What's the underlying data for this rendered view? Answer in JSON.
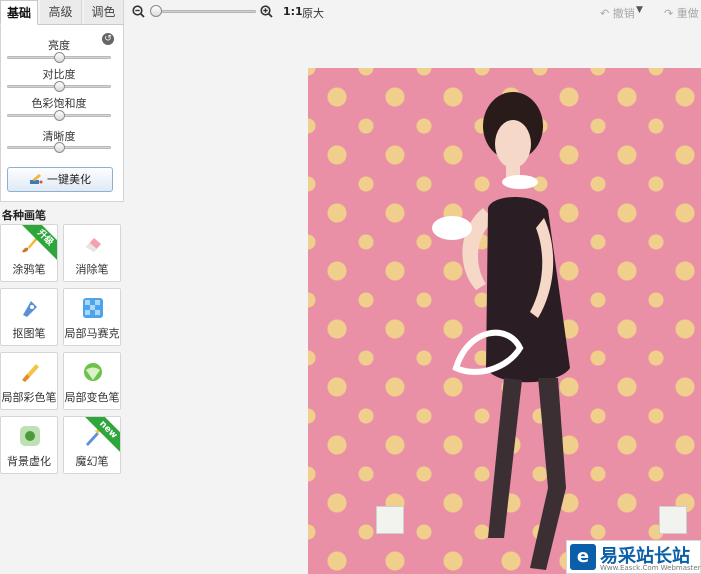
{
  "tabs": [
    {
      "label": "基础",
      "active": true
    },
    {
      "label": "高级",
      "active": false
    },
    {
      "label": "调色",
      "active": false
    }
  ],
  "adjust": {
    "sliders": [
      {
        "label": "亮度",
        "value": 0.5
      },
      {
        "label": "对比度",
        "value": 0.5
      },
      {
        "label": "色彩饱和度",
        "value": 0.5
      },
      {
        "label": "清晰度",
        "value": 0.5
      }
    ],
    "beautify_label": "一键美化"
  },
  "brushes": {
    "title": "各种画笔",
    "tools": [
      {
        "label": "涂鸦笔",
        "badge": "升级",
        "icon": "paintbrush-icon"
      },
      {
        "label": "消除笔",
        "badge": "",
        "icon": "eraser-icon"
      },
      {
        "label": "抠图笔",
        "badge": "",
        "icon": "cutout-pen-icon"
      },
      {
        "label": "局部马赛克",
        "badge": "",
        "icon": "mosaic-icon"
      },
      {
        "label": "局部彩色笔",
        "badge": "",
        "icon": "color-brush-icon"
      },
      {
        "label": "局部变色笔",
        "badge": "",
        "icon": "recolor-brush-icon"
      },
      {
        "label": "背景虚化",
        "badge": "",
        "icon": "blur-background-icon"
      },
      {
        "label": "魔幻笔",
        "badge": "new",
        "icon": "magic-wand-icon"
      }
    ]
  },
  "toolbar": {
    "zoom_level": 0.0,
    "ratio_label": "1:1",
    "original_label": "原大",
    "undo_label": "撤销",
    "redo_label": "重做"
  },
  "watermark": {
    "logo_letter": "e",
    "name": "易采站长站",
    "sub": "Www.Easck.Com Webmaster"
  },
  "colors": {
    "accent": "#0b5fa8",
    "ribbon": "#2ea63b",
    "wallpaper": "#e98fa6",
    "flower": "#f0cf8c"
  }
}
